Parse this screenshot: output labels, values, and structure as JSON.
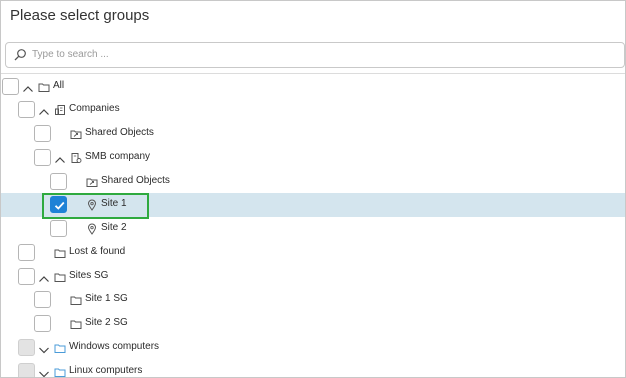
{
  "title": "Please select groups",
  "search": {
    "placeholder": "Type to search ..."
  },
  "tree": [
    {
      "label": "All",
      "icon": "folder-icon",
      "expand": "collapse",
      "checked": false,
      "disabled": false,
      "selected": false
    },
    {
      "label": "Companies",
      "icon": "companies-icon",
      "expand": "collapse",
      "checked": false,
      "disabled": false,
      "selected": false
    },
    {
      "label": "Shared Objects",
      "icon": "shared-folder-icon",
      "expand": "none",
      "checked": false,
      "disabled": false,
      "selected": false
    },
    {
      "label": "SMB company",
      "icon": "company-icon",
      "expand": "collapse",
      "checked": false,
      "disabled": false,
      "selected": false
    },
    {
      "label": "Shared Objects",
      "icon": "shared-folder-icon",
      "expand": "none",
      "checked": false,
      "disabled": false,
      "selected": false
    },
    {
      "label": "Site 1",
      "icon": "location-pin-icon",
      "expand": "none",
      "checked": true,
      "disabled": false,
      "selected": true
    },
    {
      "label": "Site 2",
      "icon": "location-pin-icon",
      "expand": "none",
      "checked": false,
      "disabled": false,
      "selected": false
    },
    {
      "label": "Lost & found",
      "icon": "folder-icon",
      "expand": "none",
      "checked": false,
      "disabled": false,
      "selected": false
    },
    {
      "label": "Sites SG",
      "icon": "folder-icon",
      "expand": "collapse",
      "checked": false,
      "disabled": false,
      "selected": false
    },
    {
      "label": "Site 1 SG",
      "icon": "folder-icon",
      "expand": "none",
      "checked": false,
      "disabled": false,
      "selected": false
    },
    {
      "label": "Site 2 SG",
      "icon": "folder-icon",
      "expand": "none",
      "checked": false,
      "disabled": false,
      "selected": false
    },
    {
      "label": "Windows computers",
      "icon": "blue-folder-icon",
      "expand": "expand",
      "checked": false,
      "disabled": true,
      "selected": false
    },
    {
      "label": "Linux computers",
      "icon": "blue-folder-icon",
      "expand": "expand",
      "checked": false,
      "disabled": true,
      "selected": false
    }
  ],
  "colors": {
    "accent": "#1e82d6",
    "selected_row": "#d4e5ee",
    "focus_outline": "#2faa3f",
    "blue_folder": "#4a9bd8"
  }
}
